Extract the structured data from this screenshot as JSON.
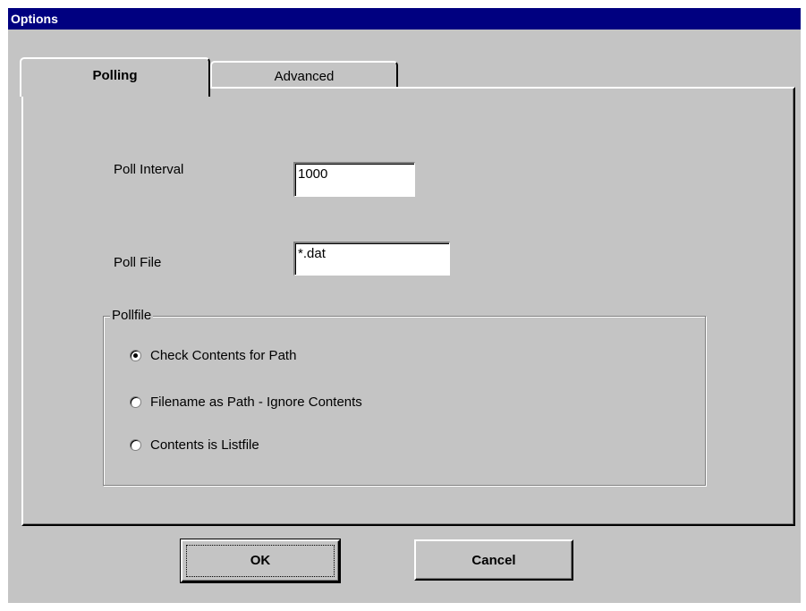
{
  "window": {
    "title": "Options"
  },
  "tabs": [
    {
      "label": "Polling",
      "active": true
    },
    {
      "label": "Advanced",
      "active": false
    }
  ],
  "fields": {
    "poll_interval": {
      "label": "Poll Interval",
      "value": "1000"
    },
    "poll_file": {
      "label": "Poll File",
      "value": "*.dat"
    }
  },
  "pollfile_group": {
    "legend": "Pollfile",
    "options": [
      {
        "label": "Check Contents for Path",
        "selected": true
      },
      {
        "label": "Filename as Path - Ignore Contents",
        "selected": false
      },
      {
        "label": "Contents is Listfile",
        "selected": false
      }
    ]
  },
  "buttons": {
    "ok": "OK",
    "cancel": "Cancel"
  },
  "colors": {
    "titlebar": "#000080",
    "face": "#c4c4c4"
  }
}
